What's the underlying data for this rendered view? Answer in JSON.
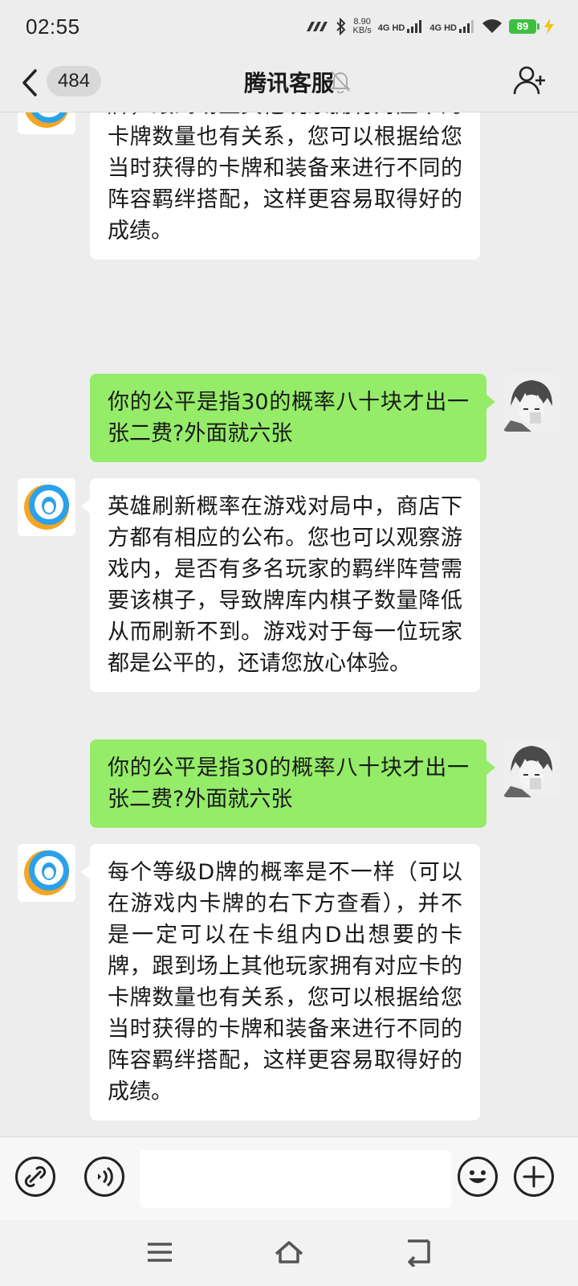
{
  "status_bar": {
    "time": "02:55",
    "net_speed_value": "8.90",
    "net_speed_unit": "KB/s",
    "sim1": "4G HD",
    "sim2": "4G HD",
    "battery": "89"
  },
  "header": {
    "unread_count": "484",
    "title": "腾讯客服"
  },
  "messages": [
    {
      "side": "left",
      "sender": "腾讯客服",
      "text": "每个等级D牌的概率是不一样（可以在游戏内卡牌的右下方查看），并不是一定可以在卡组内D出想要的卡牌，跟到场上其他玩家拥有对应卡的卡牌数量也有关系，您可以根据给您当时获得的卡牌和装备来进行不同的阵容羁绊搭配，这样更容易取得好的成绩。"
    },
    {
      "side": "right",
      "sender": "me",
      "text": "你的公平是指30的概率八十块才出一张二费?外面就六张"
    },
    {
      "side": "left",
      "sender": "腾讯客服",
      "text": "英雄刷新概率在游戏对局中，商店下方都有相应的公布。您也可以观察游戏内，是否有多名玩家的羁绊阵营需要该棋子，导致牌库内棋子数量降低从而刷新不到。游戏对于每一位玩家都是公平的，还请您放心体验。"
    },
    {
      "side": "right",
      "sender": "me",
      "text": "你的公平是指30的概率八十块才出一张二费?外面就六张"
    },
    {
      "side": "left",
      "sender": "腾讯客服",
      "text": "每个等级D牌的概率是不一样（可以在游戏内卡牌的右下方查看），并不是一定可以在卡组内D出想要的卡牌，跟到场上其他玩家拥有对应卡的卡牌数量也有关系，您可以根据给您当时获得的卡牌和装备来进行不同的阵容羁绊搭配，这样更容易取得好的成绩。"
    }
  ],
  "input_bar": {
    "placeholder": "",
    "icons": [
      "link-icon",
      "voice-icon",
      "emoji-icon",
      "plus-icon"
    ]
  },
  "nav_bar": {
    "icons": [
      "menu-icon",
      "home-icon",
      "back-nav-icon"
    ]
  },
  "colors": {
    "background": "#ededed",
    "outgoing_bubble": "#95ec69",
    "incoming_bubble": "#ffffff",
    "battery": "#3fbf3f"
  }
}
